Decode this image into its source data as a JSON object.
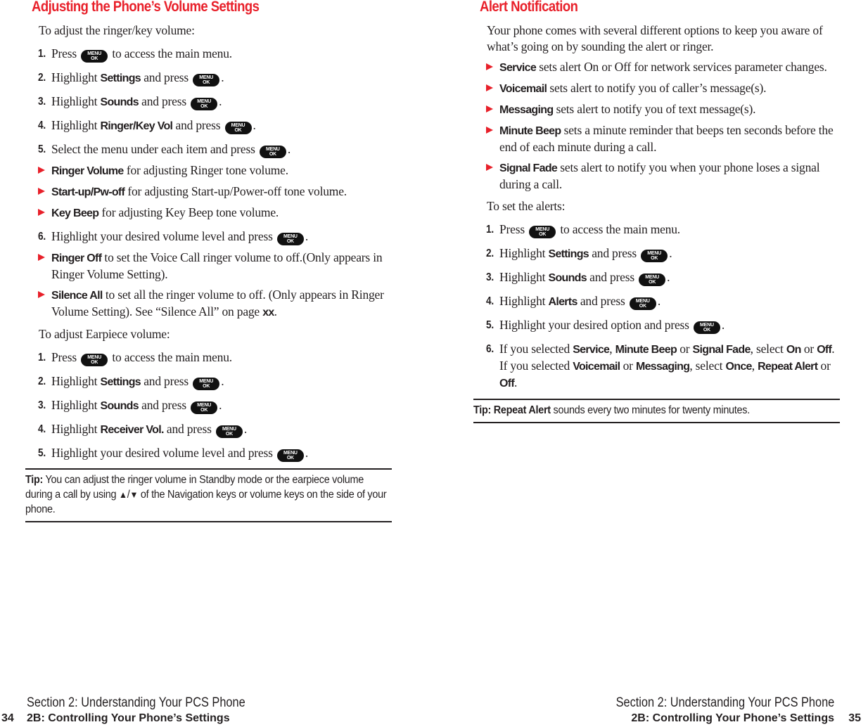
{
  "left_page": {
    "heading": "Adjusting the Phone’s Volume Settings",
    "ringer_intro": "To adjust the ringer/key volume:",
    "ringer_steps": [
      {
        "num": "1.",
        "pre": "Press",
        "bold": "",
        "post": "to access the main menu.",
        "key": true,
        "end": ""
      },
      {
        "num": "2.",
        "pre": "Highlight",
        "bold": "Settings",
        "post": "and press",
        "key": true,
        "end": "."
      },
      {
        "num": "3.",
        "pre": "Highlight",
        "bold": "Sounds",
        "post": "and press",
        "key": true,
        "end": "."
      },
      {
        "num": "4.",
        "pre": "Highlight",
        "bold": "Ringer/Key Vol",
        "post": "and press",
        "key": true,
        "end": "."
      },
      {
        "num": "5.",
        "pre": "Select the menu under each item and press",
        "bold": "",
        "post": "",
        "key": true,
        "end": "."
      }
    ],
    "step5_bullets": [
      {
        "bold": "Ringer Volume",
        "text": "for adjusting Ringer tone volume."
      },
      {
        "bold": "Start-up/Pw-off",
        "text": "for adjusting Start-up/Power-off tone volume."
      },
      {
        "bold": "Key Beep",
        "text": "for adjusting Key Beep tone volume."
      }
    ],
    "step6": {
      "num": "6.",
      "text": "Highlight your desired volume level and press",
      "end": "."
    },
    "step6_bullets": [
      {
        "bold": "Ringer Off",
        "text": "to set the Voice Call ringer volume to off.(Only appears in Ringer Volume Setting).",
        "suffix_bold": "",
        "suffix": ""
      },
      {
        "bold": "Silence All",
        "text": "to set all the ringer volume to off. (Only appears in Ringer Volume Setting). See “Silence All” on page",
        "suffix_bold": "xx",
        "suffix": "."
      }
    ],
    "earpiece_intro": "To adjust Earpiece volume:",
    "earpiece_steps": [
      {
        "num": "1.",
        "pre": "Press",
        "bold": "",
        "post": "to access the main menu.",
        "end": ""
      },
      {
        "num": "2.",
        "pre": "Highlight",
        "bold": "Settings",
        "post": "and press",
        "end": "."
      },
      {
        "num": "3.",
        "pre": "Highlight",
        "bold": "Sounds",
        "post": "and press",
        "end": "."
      },
      {
        "num": "4.",
        "pre": "Highlight",
        "bold": "Receiver Vol.",
        "post": "and press",
        "end": "."
      },
      {
        "num": "5.",
        "pre": "Highlight your desired volume level and press",
        "bold": "",
        "post": "",
        "end": "."
      }
    ],
    "tip": {
      "label": "Tip:",
      "text_before": "You can adjust the ringer volume in Standby mode or the earpiece volume during a call by using",
      "up_glyph": "▲",
      "slash": "/",
      "down_glyph": "▼",
      "text_after": "of the Navigation keys or volume keys on the side of your phone."
    }
  },
  "right_page": {
    "heading": "Alert Notification",
    "intro": "Your phone comes with several different options to keep you aware of what’s going on by sounding the alert or ringer.",
    "bullets": [
      {
        "bold": "Service",
        "text": "sets alert On or Off for network services parameter changes."
      },
      {
        "bold": "Voicemail",
        "text": "sets alert to notify you of caller’s message(s)."
      },
      {
        "bold": "Messaging",
        "text": "sets alert to notify you of text message(s)."
      },
      {
        "bold": "Minute Beep",
        "text": "sets a minute reminder that beeps ten seconds before the end of each minute during a call."
      },
      {
        "bold": "Signal Fade",
        "text": "sets alert to notify you when your phone loses a signal during a call."
      }
    ],
    "set_intro": "To set the alerts:",
    "steps": [
      {
        "num": "1.",
        "pre": "Press",
        "bold": "",
        "post": "to access the main menu.",
        "end": ""
      },
      {
        "num": "2.",
        "pre": "Highlight",
        "bold": "Settings",
        "post": "and press",
        "end": "."
      },
      {
        "num": "3.",
        "pre": "Highlight",
        "bold": "Sounds",
        "post": "and press",
        "end": "."
      },
      {
        "num": "4.",
        "pre": "Highlight",
        "bold": "Alerts",
        "post": "and press",
        "end": "."
      },
      {
        "num": "5.",
        "pre": "Highlight your desired option and press",
        "bold": "",
        "post": "",
        "end": "."
      }
    ],
    "step6": {
      "num": "6.",
      "parts": [
        {
          "t": "If you selected ",
          "b": false
        },
        {
          "t": "Service",
          "b": true
        },
        {
          "t": ", ",
          "b": false
        },
        {
          "t": "Minute Beep",
          "b": true
        },
        {
          "t": " or ",
          "b": false
        },
        {
          "t": "Signal Fade",
          "b": true
        },
        {
          "t": ", select ",
          "b": false
        },
        {
          "t": "On",
          "b": true
        },
        {
          "t": " or ",
          "b": false
        },
        {
          "t": "Off",
          "b": true
        },
        {
          "t": ". If you selected ",
          "b": false
        },
        {
          "t": "Voicemail",
          "b": true
        },
        {
          "t": " or ",
          "b": false
        },
        {
          "t": "Messaging",
          "b": true
        },
        {
          "t": ", select ",
          "b": false
        },
        {
          "t": "Once",
          "b": true
        },
        {
          "t": ", ",
          "b": false
        },
        {
          "t": "Repeat Alert",
          "b": true
        },
        {
          "t": " or ",
          "b": false
        },
        {
          "t": "Off",
          "b": true
        },
        {
          "t": ".",
          "b": false
        }
      ]
    },
    "tip": {
      "label": "Tip:",
      "bold": "Repeat Alert",
      "text": "sounds every two minutes for twenty minutes."
    }
  },
  "menu_key": {
    "top": "MENU",
    "bottom": "OK",
    "icon": "menu-ok-key-icon"
  },
  "footer_left": {
    "section": "Section 2: Understanding Your PCS Phone",
    "page_number": "34",
    "chapter": "2B: Controlling Your Phone’s Settings"
  },
  "footer_right": {
    "section": "Section 2: Understanding Your PCS Phone",
    "chapter": "2B: Controlling Your Phone’s Settings",
    "page_number": "35"
  },
  "colors": {
    "heading_red": "#e8202a",
    "text": "#231f20"
  }
}
